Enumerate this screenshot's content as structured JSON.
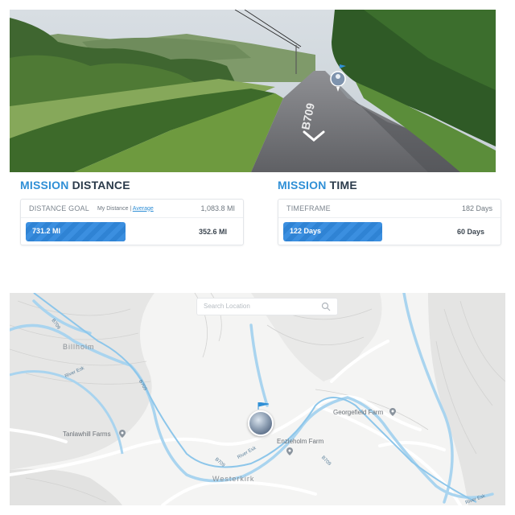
{
  "mission_distance": {
    "title_accent": "MISSION",
    "title_rest": "DISTANCE",
    "goal_label": "DISTANCE GOAL",
    "toggle_my": "My Distance |",
    "toggle_avg": "Average",
    "goal_value": "1,083.8 MI",
    "progress_label": "731.2 MI",
    "progress_fraction": 0.675,
    "remaining": "352.6 MI"
  },
  "mission_time": {
    "title_accent": "MISSION",
    "title_rest": "TIME",
    "timeframe_label": "TIMEFRAME",
    "timeframe_value": "182 Days",
    "progress_label": "122 Days",
    "progress_fraction": 0.67,
    "remaining": "60 Days"
  },
  "streetview": {
    "road_marking": "B709",
    "nav_icon": "chevron-down-icon"
  },
  "map": {
    "search_placeholder": "Search Location",
    "search_icon": "magnifier-icon",
    "labels": {
      "billholm": "Billholm",
      "westerkirk": "Westerkirk",
      "river_esk_1": "River Esk",
      "river_esk_2": "River Esk",
      "river_esk_3": "River Esk",
      "b709_1": "B709",
      "b709_2": "B709",
      "b709_3": "B709",
      "b709_4": "B709"
    },
    "pois": {
      "georgefield": "Georgefield Farm",
      "tanlawhill": "Tanlawhill Farms",
      "enzieholm": "Enzieholm Farm"
    }
  },
  "colors": {
    "accent": "#2f8fd6",
    "progress": "#3b8fe0",
    "river": "#a9d4ef",
    "road": "#ffffff"
  }
}
